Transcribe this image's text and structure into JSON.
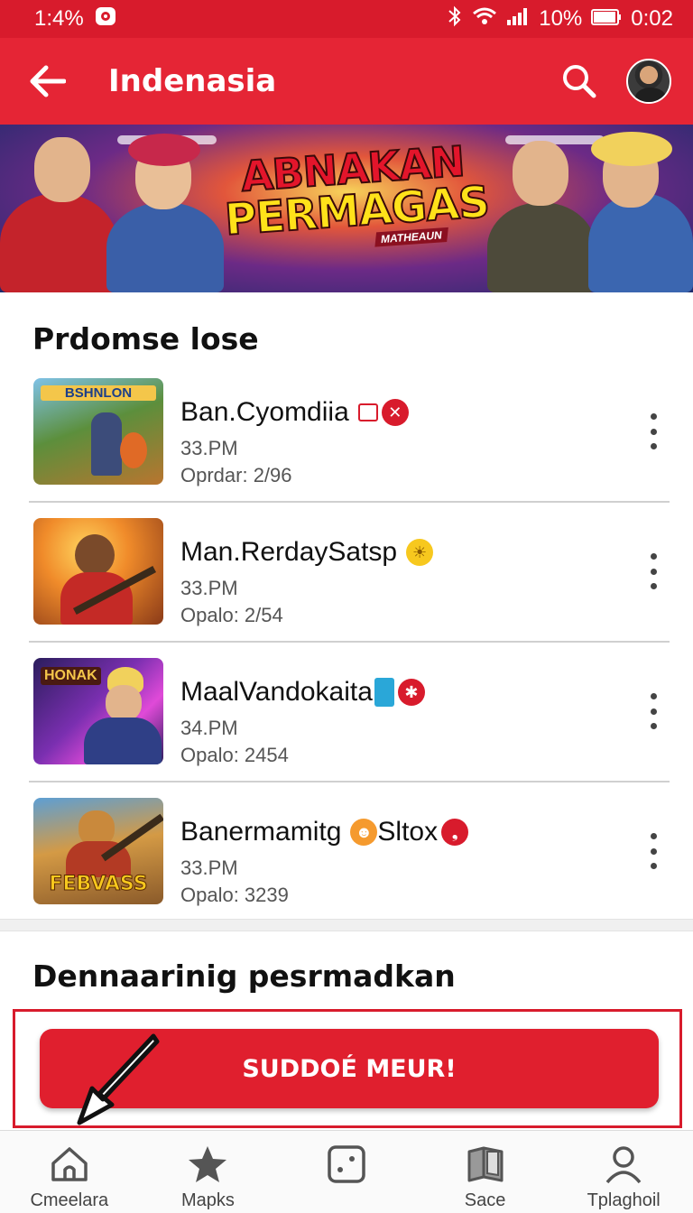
{
  "status_bar": {
    "left_text": "1:4%",
    "battery": "10%",
    "time": "0:02"
  },
  "app_bar": {
    "title": "Indenasia"
  },
  "banner": {
    "line1": "ABNAKAN",
    "line2": "PERMAGAS",
    "subtitle": "MATHEAUN"
  },
  "section1": {
    "title": "Prdomse lose",
    "items": [
      {
        "title": "Ban.Cyomdiia",
        "time": "33.PM",
        "meta": "Oprdar: 2/96",
        "badges": [
          "card-icon",
          "x-mark-icon"
        ]
      },
      {
        "title": "Man.RerdaySatsp",
        "time": "33.PM",
        "meta": "Opalo: 2/54",
        "badges": [
          "sun-icon"
        ]
      },
      {
        "title": "MaalVandokaita",
        "time": "34.PM",
        "meta": "Opalo: 2454",
        "badges": [
          "blue-square-icon",
          "red-devil-icon"
        ]
      },
      {
        "title": "Banermamitg",
        "title_suffix": "Sltox",
        "time": "33.PM",
        "meta": "Opalo: 3239",
        "badges": [
          "orange-face-icon",
          "red-comma-icon"
        ]
      }
    ],
    "thumb_texts": [
      "BSHNLON",
      "",
      "HONAK",
      "FEBVASS"
    ]
  },
  "section2": {
    "title": "Dennaarinig pesrmadkan"
  },
  "cta": {
    "label": "SUDDOÉ MEUR!"
  },
  "bottom_nav": [
    {
      "label": "Cmeelara",
      "icon": "home-icon"
    },
    {
      "label": "Mapks",
      "icon": "star-icon"
    },
    {
      "label": "",
      "icon": "dice-icon"
    },
    {
      "label": "Sace",
      "icon": "book-icon"
    },
    {
      "label": "Tplaghoil",
      "icon": "profile-icon"
    }
  ],
  "colors": {
    "primary": "#e52535",
    "status_bar": "#d81b2c",
    "cta": "#e01f2e"
  }
}
